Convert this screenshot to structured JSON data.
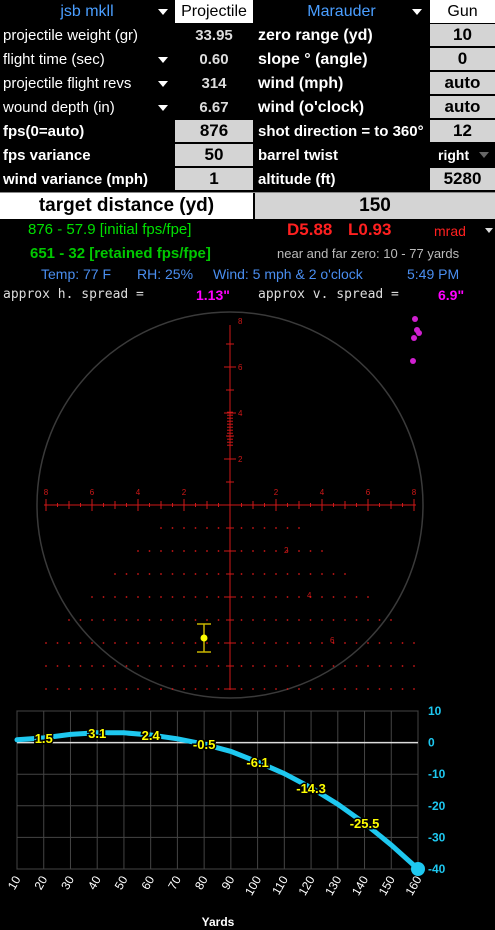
{
  "header": {
    "pellet_name": "jsb mkll",
    "projectile_col": "Projectile",
    "gun_name": "Marauder",
    "gun_col": "Gun"
  },
  "left_rows": [
    {
      "label": "projectile weight (gr)",
      "value": "33.95",
      "dropdown": false
    },
    {
      "label": "flight time (sec)",
      "value": "0.60",
      "dropdown": true
    },
    {
      "label": "projectile flight revs",
      "value": "314",
      "dropdown": true
    },
    {
      "label": "wound depth (in)",
      "value": "6.67",
      "dropdown": true
    }
  ],
  "right_rows": [
    {
      "label": "zero range (yd)",
      "value": "10"
    },
    {
      "label": "slope ° (angle)",
      "value": "0"
    },
    {
      "label": "wind (mph)",
      "value": "auto"
    },
    {
      "label": "wind (o'clock)",
      "value": "auto"
    }
  ],
  "inputs_left": [
    {
      "label": "fps(0=auto)",
      "value": "876"
    },
    {
      "label": "fps variance",
      "value": "50"
    },
    {
      "label": "wind variance (mph)",
      "value": "1"
    }
  ],
  "inputs_right": [
    {
      "label": "shot direction = to 360°",
      "value": "12"
    },
    {
      "label": "barrel twist",
      "value": "right"
    },
    {
      "label": "altitude (ft)",
      "value": "5280"
    }
  ],
  "target": {
    "label": "target distance (yd)",
    "value": "150"
  },
  "info": {
    "initial": "876 - 57.9 [initial fps/fpe]",
    "drop": "D5.88",
    "lead": "L0.93",
    "unit": "mrad",
    "retained": "651 - 32 [retained fps/fpe]",
    "zero": "near and far zero: 10  -  77 yards",
    "temp": "Temp: 77 F",
    "rh": "RH: 25%",
    "wind": "Wind: 5 mph & 2 o'clock",
    "time": "5:49 PM",
    "hspread_label": "approx h. spread =",
    "hspread_value": "1.13\"",
    "vspread_label": "approx v. spread =",
    "vspread_value": "6.9\""
  },
  "reticle": {
    "top_labels": [
      "8",
      "6",
      "4",
      "2"
    ],
    "side_labels": [
      "8",
      "6",
      "4",
      "2",
      "2",
      "4",
      "6",
      "8"
    ],
    "low_labels": [
      "2",
      "4",
      "6"
    ]
  },
  "colors": {
    "accent": "#4a9eff",
    "green": "#00e000",
    "red": "#ff2020",
    "magenta": "#ff00ff",
    "curve": "#1ec8f0",
    "yellow": "#ffff00"
  },
  "chart_data": {
    "type": "line",
    "xlabel": "Yards",
    "ylabel": "",
    "xlim": [
      10,
      160
    ],
    "ylim": [
      -40,
      10
    ],
    "x_ticks": [
      10,
      20,
      30,
      40,
      50,
      60,
      70,
      80,
      90,
      100,
      110,
      120,
      130,
      140,
      150,
      160
    ],
    "y_ticks": [
      10,
      0,
      -10,
      -20,
      -30,
      -40
    ],
    "series": [
      {
        "x": [
          10,
          20,
          30,
          40,
          50,
          60,
          70,
          77,
          80,
          90,
          100,
          110,
          120,
          130,
          140,
          150,
          160
        ],
        "values": [
          0.9,
          1.5,
          2.6,
          3.1,
          3.1,
          2.4,
          1.2,
          0,
          -0.5,
          -2.8,
          -6.1,
          -9.8,
          -14.3,
          -19.5,
          -25.5,
          -32.4,
          -40
        ]
      }
    ],
    "data_labels": [
      {
        "x": 20,
        "y": 1.5,
        "text": "1.5"
      },
      {
        "x": 40,
        "y": 3.1,
        "text": "3.1"
      },
      {
        "x": 60,
        "y": 2.4,
        "text": "2.4"
      },
      {
        "x": 80,
        "y": -0.5,
        "text": "-0.5"
      },
      {
        "x": 100,
        "y": -6.1,
        "text": "-6.1"
      },
      {
        "x": 120,
        "y": -14.3,
        "text": "-14.3"
      },
      {
        "x": 140,
        "y": -25.5,
        "text": "-25.5"
      }
    ]
  }
}
